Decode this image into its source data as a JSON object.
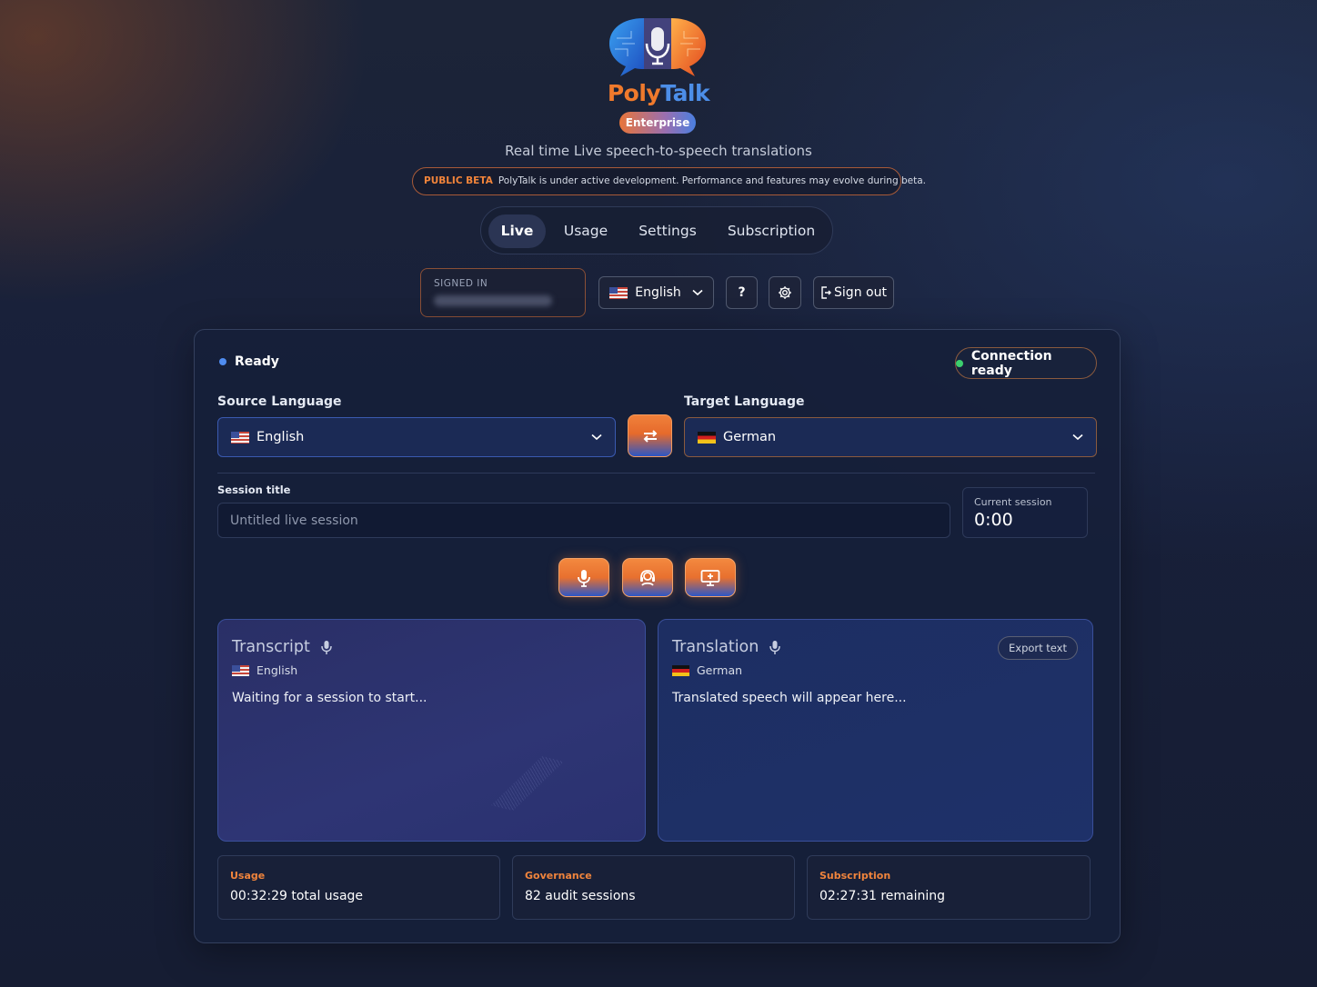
{
  "brand": {
    "poly": "Poly",
    "talk": "Talk",
    "edition": "Enterprise"
  },
  "tagline": "Real time Live speech-to-speech translations",
  "beta": {
    "tag": "PUBLIC BETA",
    "text": "PolyTalk is under active development. Performance and features may evolve during beta."
  },
  "tabs": [
    {
      "label": "Live",
      "active": true
    },
    {
      "label": "Usage",
      "active": false
    },
    {
      "label": "Settings",
      "active": false
    },
    {
      "label": "Subscription",
      "active": false
    }
  ],
  "account": {
    "signed_in_label": "SIGNED IN",
    "ui_language": "English",
    "help_label": "?",
    "sign_out_label": "Sign out"
  },
  "status": {
    "label": "Ready",
    "dot_color": "#4f8cf0",
    "connection": "Connection ready",
    "connection_dot_color": "#3ccf6e"
  },
  "languages": {
    "source_label": "Source Language",
    "source_value": "English",
    "target_label": "Target Language",
    "target_value": "German"
  },
  "session": {
    "title_label": "Session title",
    "title_placeholder": "Untitled live session",
    "current_label": "Current session",
    "current_value": "0:00"
  },
  "controls": [
    "microphone-icon",
    "headset-icon",
    "screen-share-icon"
  ],
  "transcript": {
    "title": "Transcript",
    "language": "English",
    "text": "Waiting for a session to start..."
  },
  "translation": {
    "title": "Translation",
    "language": "German",
    "text": "Translated speech will appear here...",
    "export_label": "Export text"
  },
  "stats": [
    {
      "key": "Usage",
      "value": "00:32:29 total usage"
    },
    {
      "key": "Governance",
      "value": "82 audit sessions"
    },
    {
      "key": "Subscription",
      "value": "02:27:31 remaining"
    }
  ],
  "colors": {
    "accent_orange": "#f07a2c",
    "accent_blue": "#4c8ee8"
  }
}
